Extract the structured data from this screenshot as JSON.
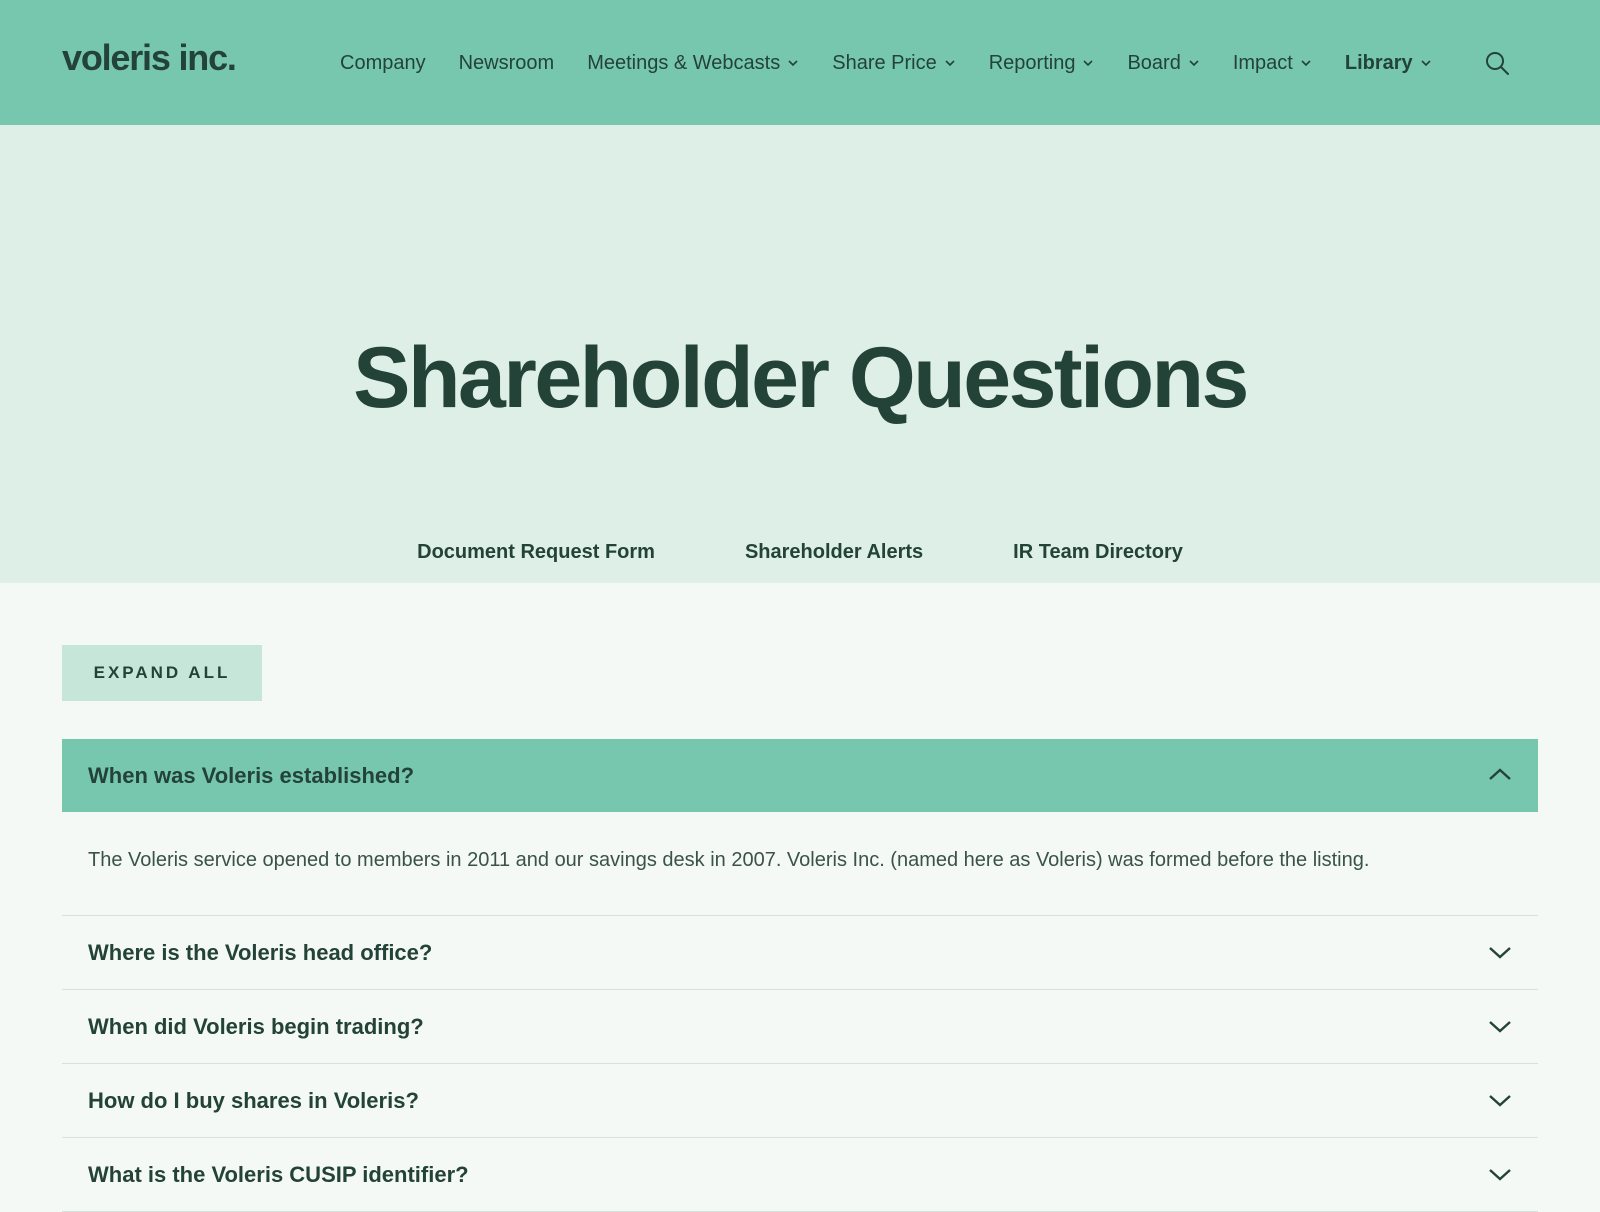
{
  "header": {
    "logo": "voleris inc.",
    "nav": [
      {
        "label": "Company",
        "has_dropdown": false
      },
      {
        "label": "Newsroom",
        "has_dropdown": false
      },
      {
        "label": "Meetings & Webcasts",
        "has_dropdown": true
      },
      {
        "label": "Share Price",
        "has_dropdown": true
      },
      {
        "label": "Reporting",
        "has_dropdown": true
      },
      {
        "label": "Board",
        "has_dropdown": true
      },
      {
        "label": "Impact",
        "has_dropdown": true
      },
      {
        "label": "Library",
        "has_dropdown": true
      }
    ],
    "search_icon": "search-icon"
  },
  "hero": {
    "title": "Shareholder Questions",
    "links": [
      "Document Request Form",
      "Shareholder Alerts",
      "IR Team Directory"
    ]
  },
  "content": {
    "expand_all_label": "EXPAND ALL",
    "faqs": [
      {
        "question": "When was Voleris established?",
        "open": true,
        "answer": "The Voleris service opened to members in 2011 and our savings desk in 2007. Voleris Inc. (named here as Voleris) was formed before the listing."
      },
      {
        "question": "Where is the Voleris head office?",
        "open": false
      },
      {
        "question": "When did Voleris begin trading?",
        "open": false
      },
      {
        "question": "How do I buy shares in Voleris?",
        "open": false
      },
      {
        "question": "What is the Voleris CUSIP identifier?",
        "open": false
      }
    ]
  },
  "colors": {
    "header_bg": "#77c7af",
    "hero_bg": "#ddefe7",
    "page_bg": "#f4f9f6",
    "button_bg": "#c5e6d9",
    "text": "#234238"
  }
}
